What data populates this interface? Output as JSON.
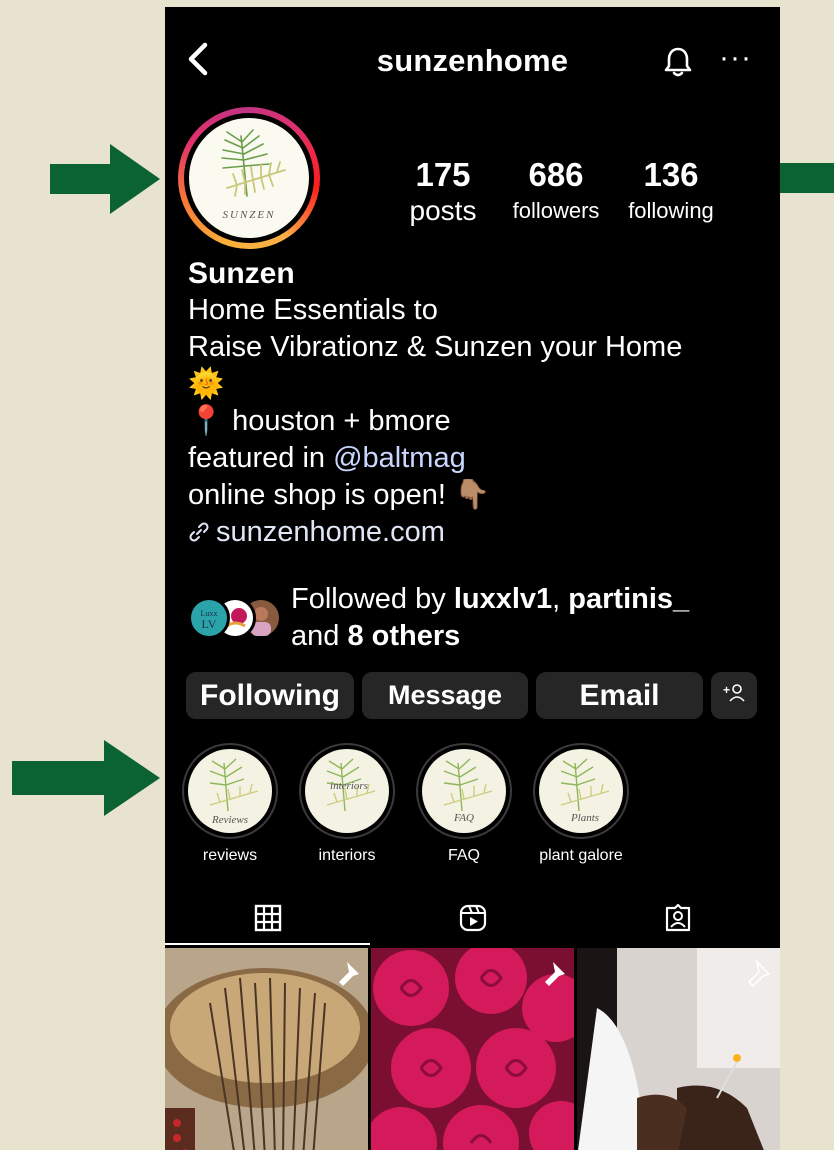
{
  "profile": {
    "username": "sunzenhome",
    "display_name": "Sunzen",
    "avatar_text": "SUNZEN",
    "stats": [
      {
        "value": "175",
        "label": "posts"
      },
      {
        "value": "686",
        "label": "followers"
      },
      {
        "value": "136",
        "label": "following"
      }
    ],
    "bio": {
      "line1": "Home Essentials to",
      "line2": "Raise Vibrationz & Sunzen your Home",
      "line3": "🌞",
      "location_pin": "📍",
      "location": " houston + bmore",
      "featured_prefix": "featured in ",
      "featured_mention": "@baltmag",
      "shop": "online shop is open! ",
      "shop_emoji": "👇🏽",
      "link": "sunzenhome.com"
    },
    "followed_by": {
      "prefix": "Followed by ",
      "user1": "luxxlv1",
      "sep": ", ",
      "user2": "partinis_",
      "and": "and ",
      "others": "8 others",
      "avatar1_text": "Luxx LV"
    }
  },
  "actions": {
    "following": "Following",
    "message": "Message",
    "email": "Email",
    "add_user": "+ዶ"
  },
  "highlights": [
    {
      "label": "reviews",
      "cover_text": "Reviews"
    },
    {
      "label": "interiors",
      "cover_text": "interiors"
    },
    {
      "label": "FAQ",
      "cover_text": "FAQ"
    },
    {
      "label": "plant galore",
      "cover_text": "Plants"
    }
  ],
  "tabs": [
    "grid-icon",
    "reels-icon",
    "tagged-icon"
  ],
  "colors": {
    "background": "#e7e3cf",
    "arrow": "#0b6232",
    "phone_bg": "#000000",
    "button_bg": "#262626",
    "mention": "#c9d7ff"
  }
}
